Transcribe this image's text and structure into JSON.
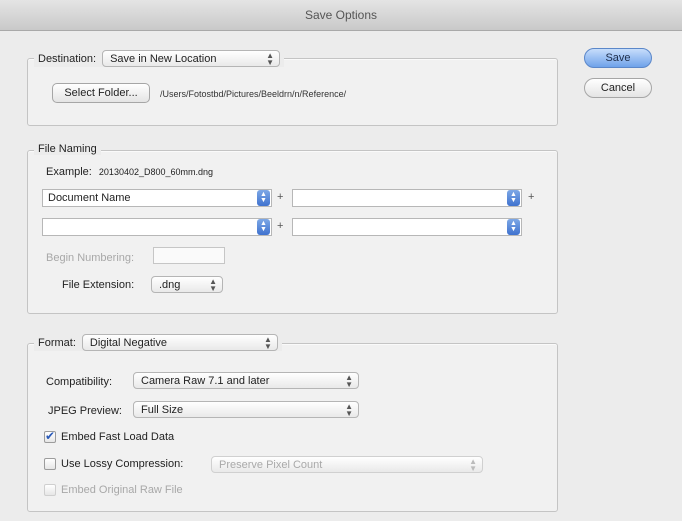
{
  "window": {
    "title": "Save Options"
  },
  "buttons": {
    "save": "Save",
    "cancel": "Cancel"
  },
  "destination": {
    "label": "Destination:",
    "value": "Save in New Location",
    "select_folder": "Select Folder...",
    "path": "/Users/Fotostbd/Pictures/Beeldrn/n/Reference/"
  },
  "file_naming": {
    "label": "File Naming",
    "example_label": "Example:",
    "example_value": "20130402_D800_60mm.dng",
    "field1": "Document Name",
    "field2": "",
    "field3": "",
    "field4": "",
    "begin_numbering_label": "Begin Numbering:",
    "begin_numbering_value": "",
    "extension_label": "File Extension:",
    "extension_value": ".dng"
  },
  "format": {
    "label": "Format:",
    "value": "Digital Negative",
    "compatibility_label": "Compatibility:",
    "compatibility_value": "Camera Raw 7.1 and later",
    "jpeg_preview_label": "JPEG Preview:",
    "jpeg_preview_value": "Full Size",
    "embed_fast_load": "Embed Fast Load Data",
    "embed_fast_load_checked": true,
    "lossy_label": "Use Lossy Compression:",
    "lossy_checked": false,
    "lossy_value": "Preserve Pixel Count",
    "embed_original": "Embed Original Raw File",
    "embed_original_checked": false
  }
}
